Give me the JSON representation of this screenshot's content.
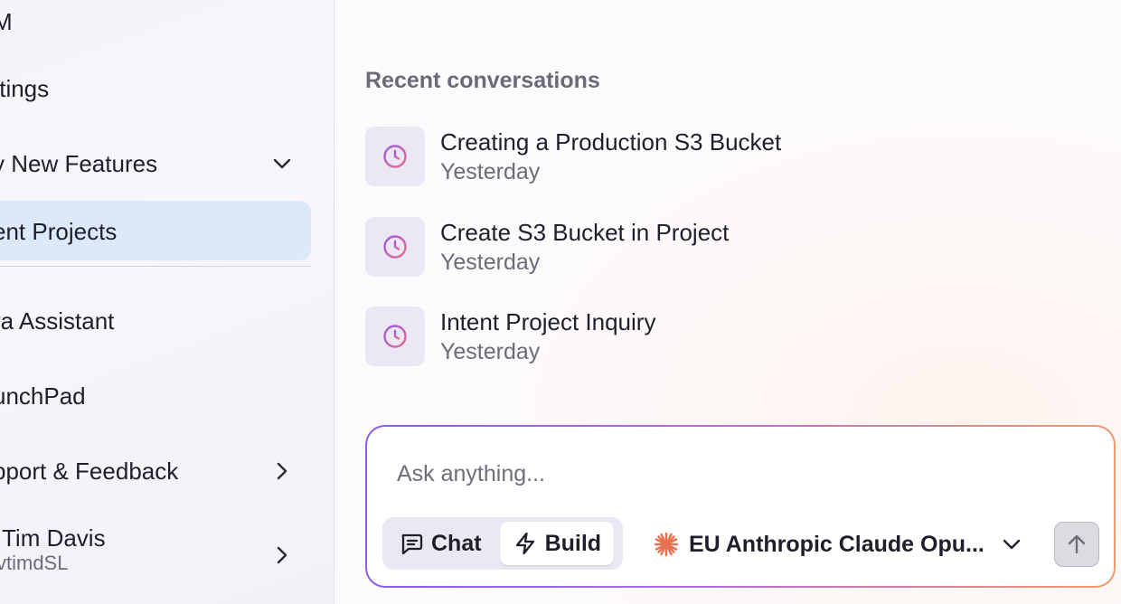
{
  "sidebar": {
    "items": [
      {
        "label": "M"
      },
      {
        "label": "ttings"
      },
      {
        "label": "y New Features"
      },
      {
        "label": "ent Projects"
      },
      {
        "label": "ra Assistant"
      },
      {
        "label": "unchPad"
      },
      {
        "label": "pport & Feedback"
      }
    ],
    "user": {
      "name": "Tim Davis",
      "handle": "vtimdSL"
    }
  },
  "main": {
    "section_title": "Recent conversations",
    "conversations": [
      {
        "title": "Creating a Production S3 Bucket",
        "time": "Yesterday"
      },
      {
        "title": "Create S3 Bucket in Project",
        "time": "Yesterday"
      },
      {
        "title": "Intent Project Inquiry",
        "time": "Yesterday"
      }
    ]
  },
  "composer": {
    "placeholder": "Ask anything...",
    "modes": [
      {
        "label": "Chat",
        "icon": "chat-icon",
        "selected": false
      },
      {
        "label": "Build",
        "icon": "lightning-icon",
        "selected": true
      }
    ],
    "model": "EU Anthropic Claude Opu...",
    "model_icon": "claude-sunburst-icon",
    "send_icon": "arrow-up-icon"
  },
  "colors": {
    "accent_active": "#dce9fb",
    "clock_gradient_start": "#9b5de5",
    "clock_gradient_end": "#e86a8a",
    "border_gradient_start": "#8b5cf6",
    "border_gradient_end": "#f19a6b",
    "claude_orange": "#e8704f"
  }
}
